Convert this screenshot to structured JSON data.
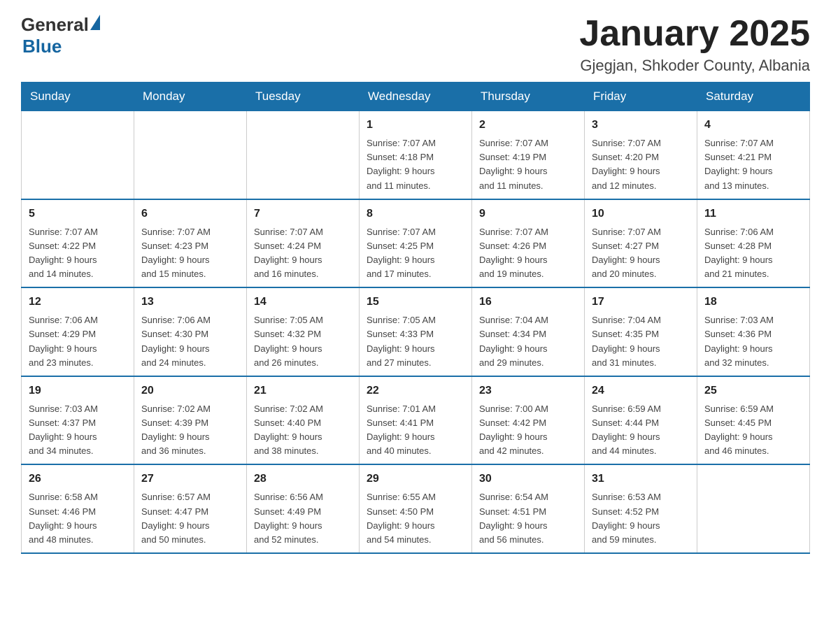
{
  "header": {
    "title": "January 2025",
    "subtitle": "Gjegjan, Shkoder County, Albania",
    "logo": {
      "general": "General",
      "blue": "Blue"
    }
  },
  "calendar": {
    "days_of_week": [
      "Sunday",
      "Monday",
      "Tuesday",
      "Wednesday",
      "Thursday",
      "Friday",
      "Saturday"
    ],
    "weeks": [
      [
        {
          "day": "",
          "info": ""
        },
        {
          "day": "",
          "info": ""
        },
        {
          "day": "",
          "info": ""
        },
        {
          "day": "1",
          "info": "Sunrise: 7:07 AM\nSunset: 4:18 PM\nDaylight: 9 hours\nand 11 minutes."
        },
        {
          "day": "2",
          "info": "Sunrise: 7:07 AM\nSunset: 4:19 PM\nDaylight: 9 hours\nand 11 minutes."
        },
        {
          "day": "3",
          "info": "Sunrise: 7:07 AM\nSunset: 4:20 PM\nDaylight: 9 hours\nand 12 minutes."
        },
        {
          "day": "4",
          "info": "Sunrise: 7:07 AM\nSunset: 4:21 PM\nDaylight: 9 hours\nand 13 minutes."
        }
      ],
      [
        {
          "day": "5",
          "info": "Sunrise: 7:07 AM\nSunset: 4:22 PM\nDaylight: 9 hours\nand 14 minutes."
        },
        {
          "day": "6",
          "info": "Sunrise: 7:07 AM\nSunset: 4:23 PM\nDaylight: 9 hours\nand 15 minutes."
        },
        {
          "day": "7",
          "info": "Sunrise: 7:07 AM\nSunset: 4:24 PM\nDaylight: 9 hours\nand 16 minutes."
        },
        {
          "day": "8",
          "info": "Sunrise: 7:07 AM\nSunset: 4:25 PM\nDaylight: 9 hours\nand 17 minutes."
        },
        {
          "day": "9",
          "info": "Sunrise: 7:07 AM\nSunset: 4:26 PM\nDaylight: 9 hours\nand 19 minutes."
        },
        {
          "day": "10",
          "info": "Sunrise: 7:07 AM\nSunset: 4:27 PM\nDaylight: 9 hours\nand 20 minutes."
        },
        {
          "day": "11",
          "info": "Sunrise: 7:06 AM\nSunset: 4:28 PM\nDaylight: 9 hours\nand 21 minutes."
        }
      ],
      [
        {
          "day": "12",
          "info": "Sunrise: 7:06 AM\nSunset: 4:29 PM\nDaylight: 9 hours\nand 23 minutes."
        },
        {
          "day": "13",
          "info": "Sunrise: 7:06 AM\nSunset: 4:30 PM\nDaylight: 9 hours\nand 24 minutes."
        },
        {
          "day": "14",
          "info": "Sunrise: 7:05 AM\nSunset: 4:32 PM\nDaylight: 9 hours\nand 26 minutes."
        },
        {
          "day": "15",
          "info": "Sunrise: 7:05 AM\nSunset: 4:33 PM\nDaylight: 9 hours\nand 27 minutes."
        },
        {
          "day": "16",
          "info": "Sunrise: 7:04 AM\nSunset: 4:34 PM\nDaylight: 9 hours\nand 29 minutes."
        },
        {
          "day": "17",
          "info": "Sunrise: 7:04 AM\nSunset: 4:35 PM\nDaylight: 9 hours\nand 31 minutes."
        },
        {
          "day": "18",
          "info": "Sunrise: 7:03 AM\nSunset: 4:36 PM\nDaylight: 9 hours\nand 32 minutes."
        }
      ],
      [
        {
          "day": "19",
          "info": "Sunrise: 7:03 AM\nSunset: 4:37 PM\nDaylight: 9 hours\nand 34 minutes."
        },
        {
          "day": "20",
          "info": "Sunrise: 7:02 AM\nSunset: 4:39 PM\nDaylight: 9 hours\nand 36 minutes."
        },
        {
          "day": "21",
          "info": "Sunrise: 7:02 AM\nSunset: 4:40 PM\nDaylight: 9 hours\nand 38 minutes."
        },
        {
          "day": "22",
          "info": "Sunrise: 7:01 AM\nSunset: 4:41 PM\nDaylight: 9 hours\nand 40 minutes."
        },
        {
          "day": "23",
          "info": "Sunrise: 7:00 AM\nSunset: 4:42 PM\nDaylight: 9 hours\nand 42 minutes."
        },
        {
          "day": "24",
          "info": "Sunrise: 6:59 AM\nSunset: 4:44 PM\nDaylight: 9 hours\nand 44 minutes."
        },
        {
          "day": "25",
          "info": "Sunrise: 6:59 AM\nSunset: 4:45 PM\nDaylight: 9 hours\nand 46 minutes."
        }
      ],
      [
        {
          "day": "26",
          "info": "Sunrise: 6:58 AM\nSunset: 4:46 PM\nDaylight: 9 hours\nand 48 minutes."
        },
        {
          "day": "27",
          "info": "Sunrise: 6:57 AM\nSunset: 4:47 PM\nDaylight: 9 hours\nand 50 minutes."
        },
        {
          "day": "28",
          "info": "Sunrise: 6:56 AM\nSunset: 4:49 PM\nDaylight: 9 hours\nand 52 minutes."
        },
        {
          "day": "29",
          "info": "Sunrise: 6:55 AM\nSunset: 4:50 PM\nDaylight: 9 hours\nand 54 minutes."
        },
        {
          "day": "30",
          "info": "Sunrise: 6:54 AM\nSunset: 4:51 PM\nDaylight: 9 hours\nand 56 minutes."
        },
        {
          "day": "31",
          "info": "Sunrise: 6:53 AM\nSunset: 4:52 PM\nDaylight: 9 hours\nand 59 minutes."
        },
        {
          "day": "",
          "info": ""
        }
      ]
    ]
  }
}
